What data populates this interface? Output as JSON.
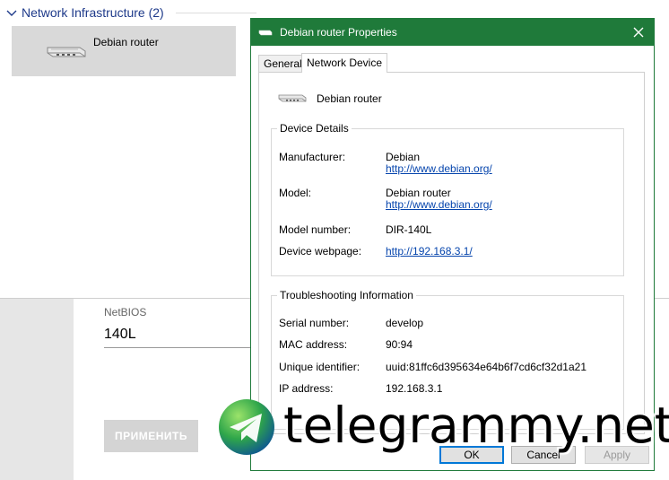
{
  "explorer": {
    "group_header": "Network Infrastructure (2)",
    "tile_label": "Debian router"
  },
  "settings": {
    "netbios_label": "NetBIOS",
    "netbios_value": "140L",
    "apply_button": "ПРИМЕНИТЬ"
  },
  "dialog": {
    "title": "Debian router Properties",
    "tabs": [
      "General",
      "Network Device"
    ],
    "active_tab": "Network Device",
    "device_name": "Debian router",
    "details": {
      "legend": "Device Details",
      "manufacturer_label": "Manufacturer:",
      "manufacturer_value": "Debian",
      "manufacturer_link": "http://www.debian.org/",
      "model_label": "Model:",
      "model_value": "Debian router",
      "model_link": "http://www.debian.org/",
      "model_number_label": "Model number:",
      "model_number_value": "DIR-140L",
      "webpage_label": "Device webpage:",
      "webpage_link": "http://192.168.3.1/"
    },
    "trouble": {
      "legend": "Troubleshooting Information",
      "serial_label": "Serial number:",
      "serial_value": "develop",
      "mac_label": "MAC address:",
      "mac_value": "90:94",
      "uid_label": "Unique identifier:",
      "uid_value": "uuid:81ffc6d395634e64b6f7cd6cf32d1a21",
      "ip_label": "IP address:",
      "ip_value": "192.168.3.1"
    },
    "buttons": {
      "ok": "OK",
      "cancel": "Cancel",
      "apply": "Apply"
    }
  },
  "watermark": {
    "text": "telegrammy.net"
  },
  "colors": {
    "titlebar": "#1f7a3a",
    "link": "#0645ad",
    "group_header": "#1e3a8a",
    "tile_selected": "#d9d9d9"
  },
  "icons": {
    "group_chevron": "chevron-down-icon",
    "router": "router-icon",
    "close": "close-icon",
    "telegram": "telegram-logo-icon"
  }
}
